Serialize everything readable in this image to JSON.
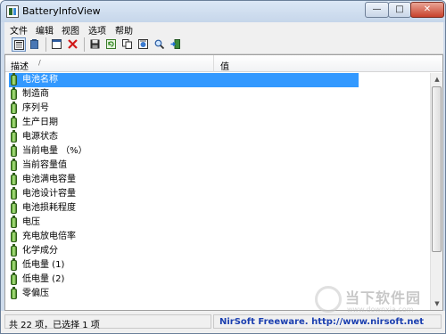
{
  "window": {
    "title": "BatteryInfoView",
    "controls": {
      "minimize": "—",
      "maximize": "□",
      "close": "✕"
    }
  },
  "menu": [
    "文件",
    "编辑",
    "视图",
    "选项",
    "帮助"
  ],
  "toolbar": {
    "buttons": [
      {
        "icon": "properties-view-icon",
        "active": true
      },
      {
        "icon": "battery-view-icon",
        "active": false
      },
      {
        "icon": "log-window-icon",
        "active": false
      },
      {
        "icon": "delete-icon",
        "active": false
      },
      {
        "icon": "save-icon",
        "active": false
      },
      {
        "icon": "refresh-icon",
        "active": false
      },
      {
        "icon": "copy-icon",
        "active": false
      },
      {
        "icon": "html-report-icon",
        "active": false
      },
      {
        "icon": "find-icon",
        "active": false
      },
      {
        "icon": "exit-icon",
        "active": false
      }
    ]
  },
  "list": {
    "columns": {
      "description": "描述",
      "value": "值"
    },
    "rows": [
      "电池名称",
      "制造商",
      "序列号",
      "生产日期",
      "电源状态",
      "当前电量 （%）",
      "当前容量值",
      "电池满电容量",
      "电池设计容量",
      "电池损耗程度",
      "电压",
      "充电放电倍率",
      "化学成分",
      "低电量 (1)",
      "低电量 (2)",
      "零偏压"
    ],
    "selected_index": 0
  },
  "status": {
    "left": "共 22 项，已选择 1 项",
    "right": "NirSoft Freeware.  http://www.nirsoft.net"
  },
  "watermark": {
    "text": "当下软件园",
    "url": "www.downxia.com"
  },
  "colors": {
    "selection": "#3399ff",
    "status_link": "#1b3fb0",
    "close_button": "#c8412c"
  }
}
